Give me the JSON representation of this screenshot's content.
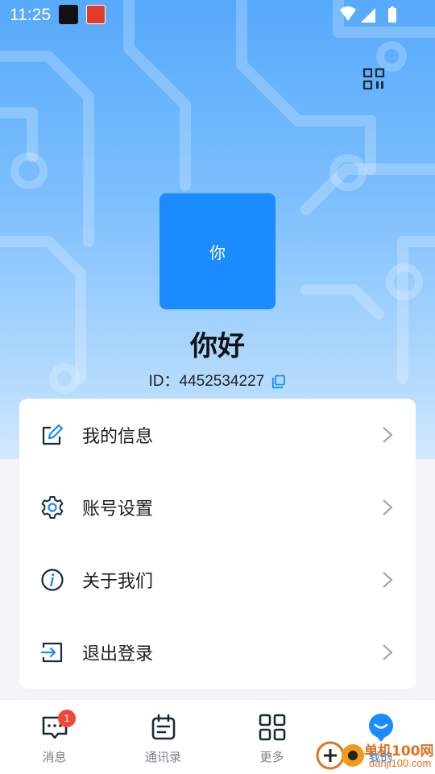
{
  "status_bar": {
    "time": "11:25"
  },
  "profile": {
    "avatar_text": "你",
    "greeting": "你好",
    "id_label": "ID：",
    "id_value": "4452534227"
  },
  "menu": {
    "items": [
      {
        "label": "我的信息",
        "icon": "edit-icon"
      },
      {
        "label": "账号设置",
        "icon": "gear-icon"
      },
      {
        "label": "关于我们",
        "icon": "info-icon"
      },
      {
        "label": "退出登录",
        "icon": "logout-icon"
      }
    ]
  },
  "tabbar": {
    "tabs": [
      {
        "label": "消息",
        "icon": "chat-icon",
        "badge": "1"
      },
      {
        "label": "通讯录",
        "icon": "contacts-icon"
      },
      {
        "label": "更多",
        "icon": "grid-icon"
      },
      {
        "label": "我的",
        "icon": "profile-icon",
        "active": true
      }
    ]
  },
  "watermark": {
    "line1": "单机100网",
    "line2": "danji100.com"
  },
  "colors": {
    "accent": "#1a8cff",
    "badge": "#f0463c",
    "hero_top": "#56a9fb"
  }
}
